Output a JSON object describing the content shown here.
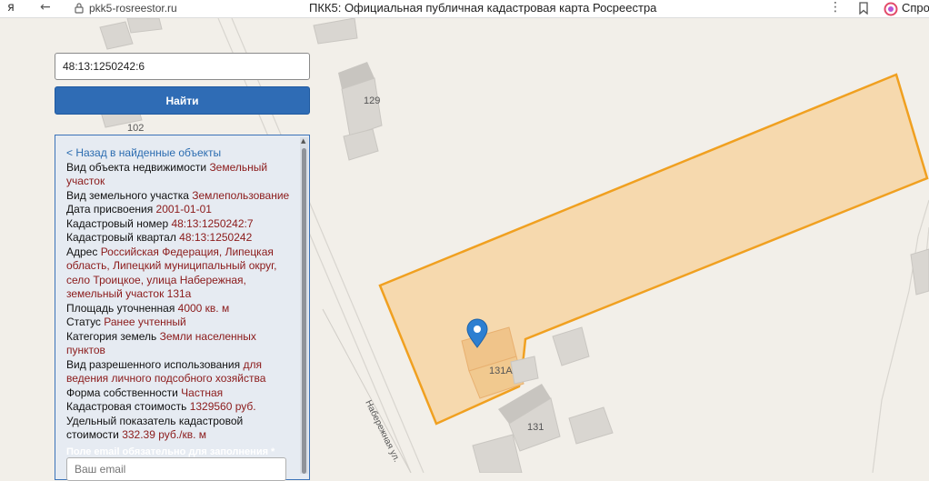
{
  "browser": {
    "logo": "я",
    "back_glyph": "←",
    "url": "pkk5-rosreestor.ru",
    "title": "ПКК5: Официальная публичная кадастровая карта Росреестра",
    "menu_glyph": "⋮",
    "ask_label": "Спро"
  },
  "map": {
    "house_labels": [
      "129",
      "102",
      "131А",
      "131"
    ],
    "street_label": "Набережная ул."
  },
  "search": {
    "value": "48:13:1250242:6",
    "button_label": "Найти"
  },
  "panel": {
    "back_link": "< Назад в найденные объекты",
    "fields": [
      {
        "label": "Вид объекта недвижимости ",
        "value": "Земельный участок"
      },
      {
        "label": "Вид земельного участка ",
        "value": "Землепользование"
      },
      {
        "label": "Дата присвоения ",
        "value": "2001-01-01"
      },
      {
        "label": "Кадастровый номер ",
        "value": "48:13:1250242:7"
      },
      {
        "label": "Кадастровый квартал ",
        "value": "48:13:1250242"
      },
      {
        "label": "Адрес ",
        "value": "Российская Федерация, Липецкая область, Липецкий муниципальный округ, село Троицкое, улица Набережная, земельный участок 131а"
      },
      {
        "label": "Площадь уточненная ",
        "value": "4000 кв. м"
      },
      {
        "label": "Статус ",
        "value": "Ранее учтенный"
      },
      {
        "label": "Категория земель ",
        "value": "Земли населенных пунктов"
      },
      {
        "label": "Вид разрешенного использования ",
        "value": "для ведения личного подсобного хозяйства"
      },
      {
        "label": "Форма собственности ",
        "value": "Частная"
      },
      {
        "label": "Кадастровая стоимость ",
        "value": "1329560 руб."
      },
      {
        "label": "Удельный показатель кадастровой стоимости ",
        "value": "332.39 руб./кв. м"
      }
    ],
    "email_required_note": "Поле email обязательно для заполнения *",
    "email_placeholder": "Ваш email"
  },
  "colors": {
    "parcel_fill": "#f7d29a",
    "parcel_stroke": "#f0a020",
    "button_blue": "#2f6cb5",
    "value_red": "#8b1a1a",
    "link_blue": "#2b6cb0",
    "marker_blue": "#2d7fd1"
  }
}
